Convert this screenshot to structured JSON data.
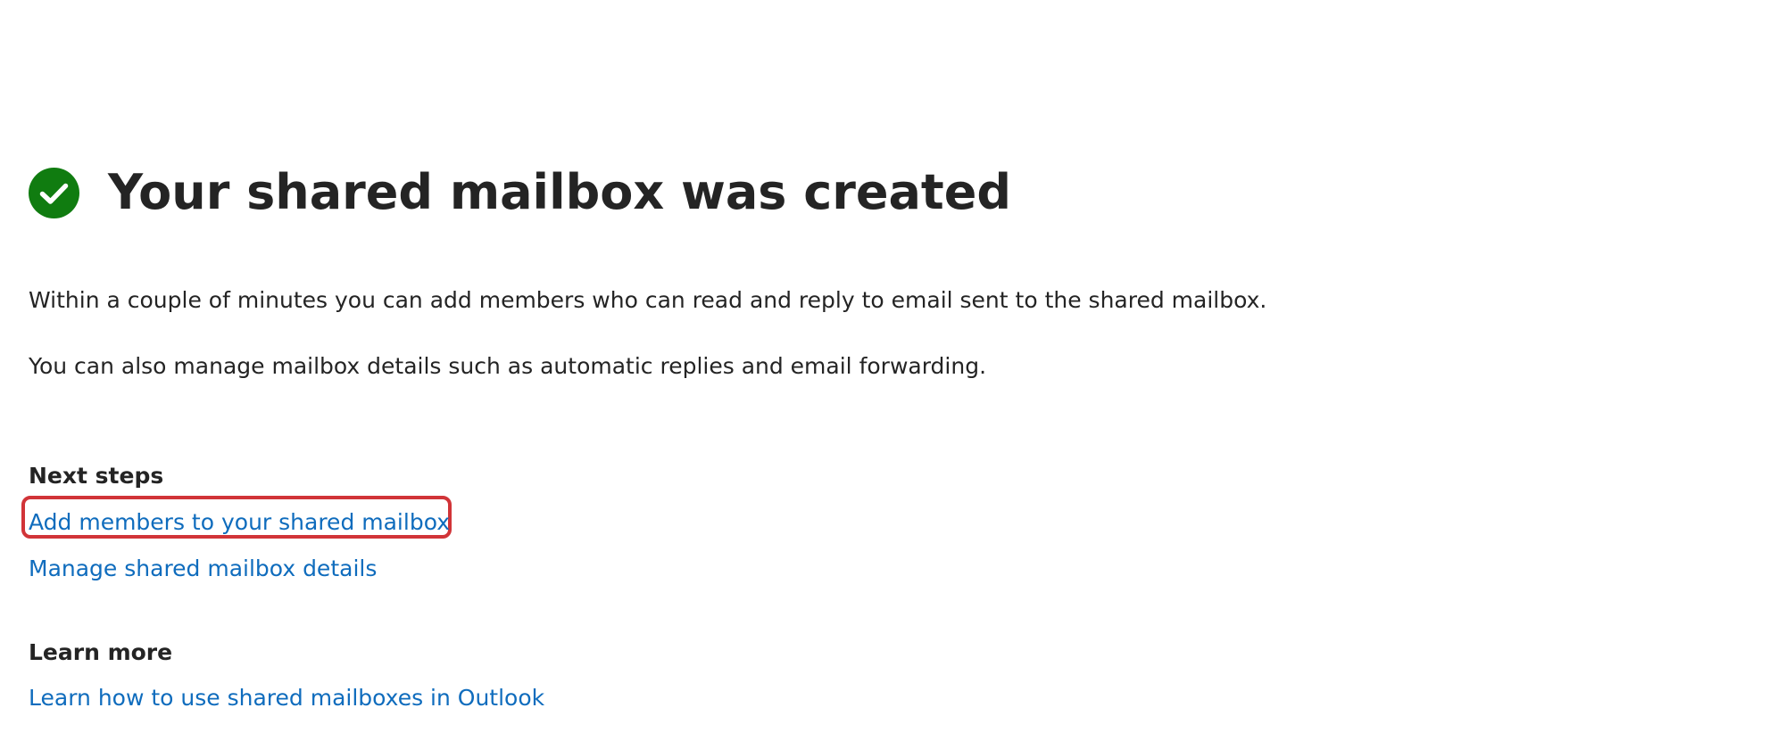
{
  "header": {
    "title": "Your shared mailbox was created",
    "icon": "check-circle-icon",
    "icon_color": "#107c10"
  },
  "body": {
    "paragraph_1": "Within a couple of minutes you can add members who can read and reply to email sent to the shared mailbox.",
    "paragraph_2": "You can also manage mailbox details such as automatic replies and email forwarding."
  },
  "next_steps": {
    "heading": "Next steps",
    "links": [
      {
        "label": "Add members to your shared mailbox",
        "highlighted": true
      },
      {
        "label": "Manage shared mailbox details"
      }
    ]
  },
  "learn_more": {
    "heading": "Learn more",
    "links": [
      {
        "label": "Learn how to use shared mailboxes in Outlook"
      }
    ]
  },
  "colors": {
    "link": "#0f6cbd",
    "text": "#242424",
    "highlight": "#d13438",
    "success": "#107c10"
  }
}
